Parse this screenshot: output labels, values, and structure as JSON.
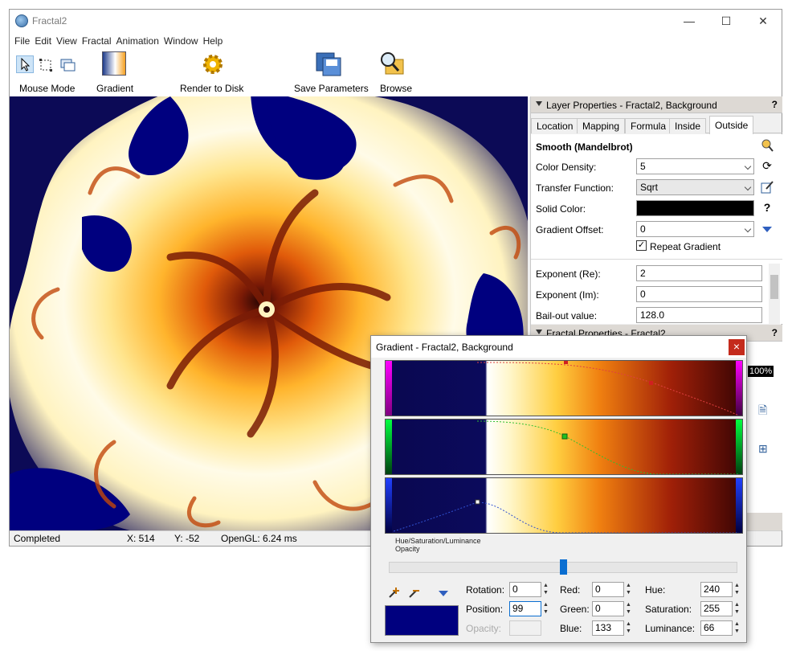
{
  "window": {
    "title": "Fractal2"
  },
  "menu": [
    "File",
    "Edit",
    "View",
    "Fractal",
    "Animation",
    "Window",
    "Help"
  ],
  "toolbar": {
    "mouse_mode": "Mouse Mode",
    "gradient": "Gradient",
    "render": "Render to Disk",
    "save": "Save Parameters",
    "browse": "Browse"
  },
  "status": {
    "state": "Completed",
    "x": "X: 514",
    "y": "Y: -52",
    "opengl": "OpenGL: 6.24 ms"
  },
  "layer_panel": {
    "title": "Layer Properties - Fractal2, Background",
    "help": "?",
    "tabs": [
      "Location",
      "Mapping",
      "Formula",
      "Inside",
      "Outside"
    ],
    "section": "Smooth (Mandelbrot)",
    "color_density_label": "Color Density:",
    "color_density": "5",
    "transfer_label": "Transfer Function:",
    "transfer": "Sqrt",
    "solid_color_label": "Solid Color:",
    "solid_color": "#000000",
    "offset_label": "Gradient Offset:",
    "offset": "0",
    "repeat_label": "Repeat Gradient",
    "exp_re_label": "Exponent (Re):",
    "exp_re": "2",
    "exp_im_label": "Exponent (Im):",
    "exp_im": "0",
    "bailout_label": "Bail-out value:",
    "bailout": "128.0"
  },
  "fractal_panel": {
    "title": "Fractal Properties - Fractal2",
    "help": "?",
    "zoom": "100%"
  },
  "gradient_dialog": {
    "title": "Gradient - Fractal2, Background",
    "close": "×",
    "hsl_label": "Hue/Saturation/Luminance",
    "opacity_section": "Opacity",
    "rotation_label": "Rotation:",
    "rotation": "0",
    "position_label": "Position:",
    "position": "99",
    "opacity_label": "Opacity:",
    "opacity": "",
    "red_label": "Red:",
    "red": "0",
    "green_label": "Green:",
    "green": "0",
    "blue_label": "Blue:",
    "blue": "133",
    "hue_label": "Hue:",
    "hue": "240",
    "saturation_label": "Saturation:",
    "saturation": "255",
    "luminance_label": "Luminance:",
    "luminance": "66",
    "swatch_color": "#00007f",
    "slider_position": 0.5
  },
  "colors": {
    "accent": "#0a6ed1",
    "deep_blue": "#0c0a56",
    "close_red": "#c42b1c"
  }
}
